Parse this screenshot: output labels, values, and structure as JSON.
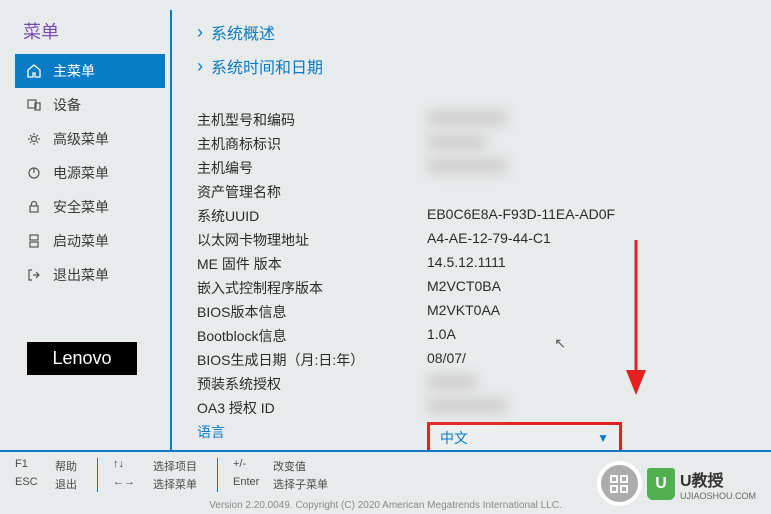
{
  "sidebar": {
    "title": "菜单",
    "items": [
      {
        "label": "主菜单",
        "icon": "home"
      },
      {
        "label": "设备",
        "icon": "devices"
      },
      {
        "label": "高级菜单",
        "icon": "settings"
      },
      {
        "label": "电源菜单",
        "icon": "power"
      },
      {
        "label": "安全菜单",
        "icon": "lock"
      },
      {
        "label": "启动菜单",
        "icon": "boot"
      },
      {
        "label": "退出菜单",
        "icon": "exit"
      }
    ]
  },
  "lenovo": "Lenovo",
  "main": {
    "nav_links": {
      "system_overview": "系统概述",
      "system_time_date": "系统时间和日期"
    },
    "info": {
      "host_model_label": "主机型号和编码",
      "host_brand_label": "主机商标标识",
      "host_number_label": "主机编号",
      "asset_tag_label": "资产管理名称",
      "system_uuid_label": "系统UUID",
      "system_uuid_value": "EB0C6E8A-F93D-11EA-AD0F",
      "ethernet_mac_label": "以太网卡物理地址",
      "ethernet_mac_value": "A4-AE-12-79-44-C1",
      "me_fw_label": "ME 固件 版本",
      "me_fw_value": "14.5.12.1111",
      "ec_fw_label": "嵌入式控制程序版本",
      "ec_fw_value": "M2VCT0BA",
      "bios_ver_label": "BIOS版本信息",
      "bios_ver_value": "M2VKT0AA",
      "bootblock_label": "Bootblock信息",
      "bootblock_value": "1.0A",
      "bios_date_label": "BIOS生成日期（月:日:年）",
      "bios_date_value": "08/07/",
      "preload_label": "预装系统授权",
      "oa3_label": "OA3 授权 ID",
      "language_label": "语言",
      "language_value": "中文"
    }
  },
  "footer": {
    "f1": {
      "key": "F1",
      "label": "帮助"
    },
    "esc": {
      "key": "ESC",
      "label": "退出"
    },
    "select_item": {
      "key": "↑↓",
      "label": "选择项目"
    },
    "select_menu": {
      "key": "←→",
      "label": "选择菜单"
    },
    "change_value": {
      "key": "+/-",
      "label": "改变值"
    },
    "sub_menu": {
      "key": "Enter",
      "label": "选择子菜单"
    }
  },
  "copyright": "Version 2.20.0049. Copyright (C) 2020 American Megatrends International LLC.",
  "watermark": {
    "brand": "U教授",
    "site": "UJIAOSHOU.COM"
  }
}
